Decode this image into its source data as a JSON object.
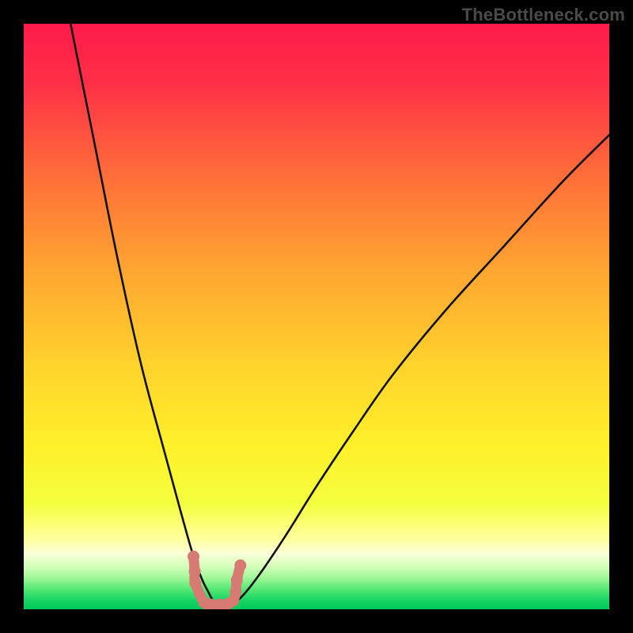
{
  "attribution": "TheBottleneck.com",
  "chart_data": {
    "type": "line",
    "title": "",
    "xlabel": "",
    "ylabel": "",
    "xlim": [
      0,
      100
    ],
    "ylim": [
      0,
      100
    ],
    "grid": false,
    "legend": false,
    "notes": "Two black curves descending from near the top-left and top-right toward a common trough around x≈33 near y≈0, with salmon dot/blob markers clustered where each curve meets the trough. Background is a vertical rainbow gradient (red→orange→yellow→green).",
    "series": [
      {
        "name": "left_curve",
        "x": [
          8,
          12,
          16,
          20,
          24,
          27,
          29,
          30.5,
          31.5,
          32.3,
          33
        ],
        "y": [
          100,
          80,
          60,
          42,
          27,
          16,
          9,
          5,
          3,
          1.5,
          0.7
        ]
      },
      {
        "name": "right_curve",
        "x": [
          36,
          38,
          41,
          45,
          50,
          56,
          63,
          72,
          82,
          92,
          100
        ],
        "y": [
          1,
          3,
          7,
          13,
          21,
          30,
          40,
          51,
          62,
          73,
          81
        ]
      },
      {
        "name": "trough_markers",
        "x": [
          29.0,
          29.2,
          29.3,
          30.8,
          32.0,
          33.5,
          34.8,
          35.8,
          36.2,
          36.4,
          37.0
        ],
        "y": [
          9.0,
          6.5,
          4.5,
          1.2,
          0.8,
          0.8,
          0.9,
          1.5,
          3.0,
          5.0,
          7.5
        ]
      }
    ],
    "background_gradient": {
      "stops": [
        {
          "offset": 0.0,
          "color": "#ff1a4b"
        },
        {
          "offset": 0.1,
          "color": "#ff2f47"
        },
        {
          "offset": 0.25,
          "color": "#ff6a3a"
        },
        {
          "offset": 0.42,
          "color": "#ffa531"
        },
        {
          "offset": 0.58,
          "color": "#ffd22c"
        },
        {
          "offset": 0.72,
          "color": "#fff029"
        },
        {
          "offset": 0.82,
          "color": "#f4ff3f"
        },
        {
          "offset": 0.88,
          "color": "#ffff9e"
        },
        {
          "offset": 0.905,
          "color": "#fbffd8"
        },
        {
          "offset": 0.925,
          "color": "#d8ffbe"
        },
        {
          "offset": 0.945,
          "color": "#a5f89a"
        },
        {
          "offset": 0.965,
          "color": "#58e876"
        },
        {
          "offset": 0.985,
          "color": "#16d463"
        },
        {
          "offset": 1.0,
          "color": "#00c95c"
        }
      ]
    },
    "colors": {
      "curve": "#111111",
      "marker": "#d77a74"
    }
  }
}
